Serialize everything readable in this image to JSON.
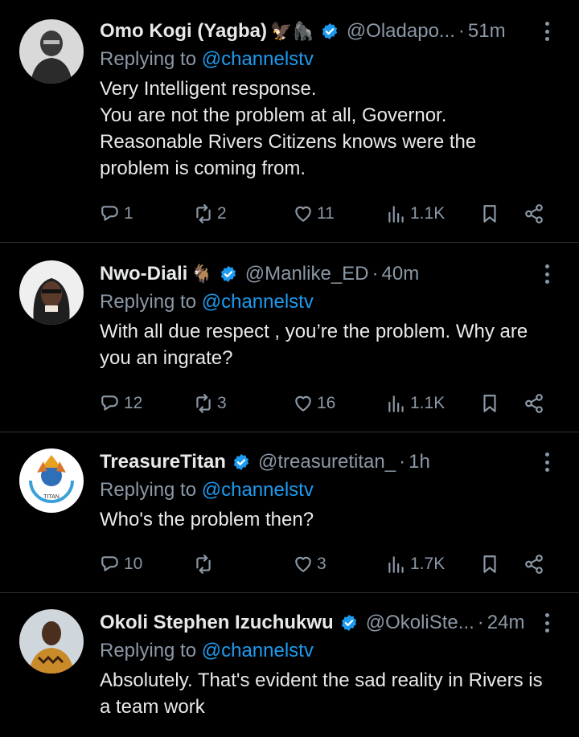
{
  "tweets": [
    {
      "name": "Omo Kogi (Yagba)",
      "emoji": "🦅🦍",
      "handle": "@Oladapo...",
      "time": "51m",
      "reply_prefix": "Replying to ",
      "reply_to": "@channelstv",
      "lines": [
        "Very Intelligent response.",
        "You are not the problem at all, Governor.",
        "Reasonable Rivers Citizens knows were the",
        "problem is coming from."
      ],
      "replies": "1",
      "retweets": "2",
      "likes": "11",
      "views": "1.1K"
    },
    {
      "name": "Nwo-Diali",
      "emoji": "🐐",
      "handle": "@Manlike_ED",
      "time": "40m",
      "reply_prefix": "Replying to ",
      "reply_to": "@channelstv",
      "lines": [
        "With all due respect , you’re the problem. Why are",
        "you an ingrate?"
      ],
      "replies": "12",
      "retweets": "3",
      "likes": "16",
      "views": "1.1K"
    },
    {
      "name": "TreasureTitan",
      "emoji": "",
      "handle": "@treasuretitan_",
      "time": "1h",
      "reply_prefix": "Replying to ",
      "reply_to": "@channelstv",
      "lines": [
        "Who's the problem then?"
      ],
      "replies": "10",
      "retweets": "",
      "likes": "3",
      "views": "1.7K"
    },
    {
      "name": "Okoli Stephen Izuchukwu",
      "emoji": "",
      "handle": "@OkoliSte...",
      "time": "24m",
      "reply_prefix": "Replying to ",
      "reply_to": "@channelstv",
      "lines": [
        "Absolutely. That's evident the sad reality in Rivers is",
        "a team work"
      ]
    }
  ],
  "time_separator": "·",
  "icons": {
    "reply": "reply-icon",
    "retweet": "retweet-icon",
    "like": "heart-icon",
    "views": "views-icon",
    "bookmark": "bookmark-icon",
    "share": "share-icon",
    "verified": "verified-badge-icon",
    "more": "more-options-icon"
  },
  "colors": {
    "background": "#000000",
    "accent": "#1d9bf0",
    "muted": "#8b98a5",
    "text": "#e7e9ea"
  }
}
